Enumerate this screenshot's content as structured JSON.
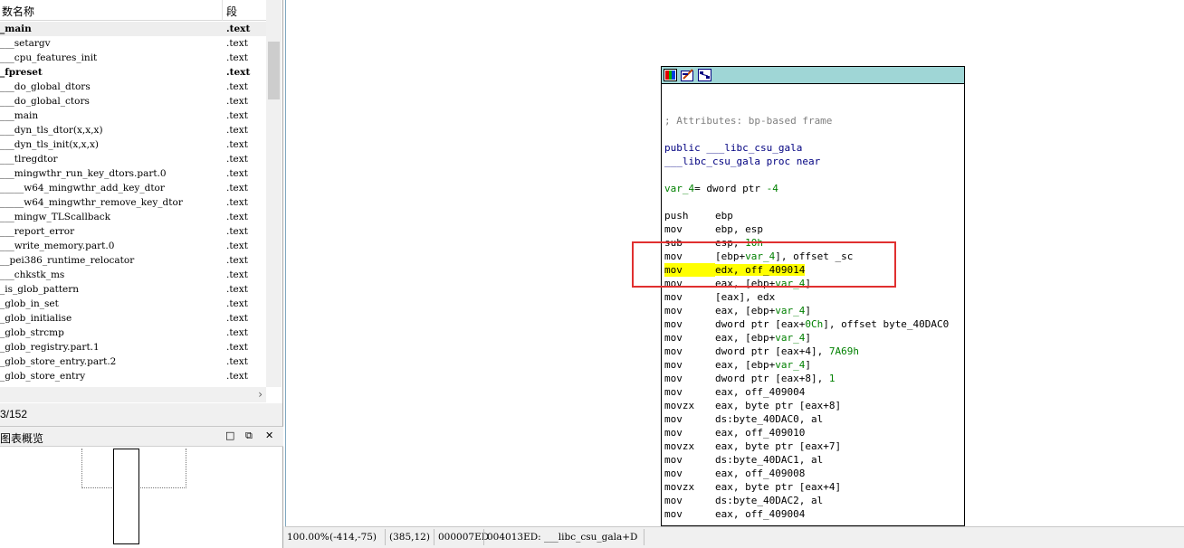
{
  "functions_panel": {
    "col_name": "数名称",
    "col_segment": "段",
    "rows": [
      {
        "name": "_main",
        "segment": ".text",
        "bold": true,
        "selected": true
      },
      {
        "name": "___setargv",
        "segment": ".text"
      },
      {
        "name": "___cpu_features_init",
        "segment": ".text"
      },
      {
        "name": "_fpreset",
        "segment": ".text",
        "bold": true
      },
      {
        "name": "___do_global_dtors",
        "segment": ".text"
      },
      {
        "name": "___do_global_ctors",
        "segment": ".text"
      },
      {
        "name": "___main",
        "segment": ".text"
      },
      {
        "name": "___dyn_tls_dtor(x,x,x)",
        "segment": ".text"
      },
      {
        "name": "___dyn_tls_init(x,x,x)",
        "segment": ".text"
      },
      {
        "name": "___tlregdtor",
        "segment": ".text"
      },
      {
        "name": "___mingwthr_run_key_dtors.part.0",
        "segment": ".text"
      },
      {
        "name": "_____w64_mingwthr_add_key_dtor",
        "segment": ".text"
      },
      {
        "name": "_____w64_mingwthr_remove_key_dtor",
        "segment": ".text"
      },
      {
        "name": "___mingw_TLScallback",
        "segment": ".text"
      },
      {
        "name": "___report_error",
        "segment": ".text"
      },
      {
        "name": "___write_memory.part.0",
        "segment": ".text"
      },
      {
        "name": "__pei386_runtime_relocator",
        "segment": ".text"
      },
      {
        "name": "___chkstk_ms",
        "segment": ".text"
      },
      {
        "name": "_is_glob_pattern",
        "segment": ".text"
      },
      {
        "name": "_glob_in_set",
        "segment": ".text"
      },
      {
        "name": "_glob_initialise",
        "segment": ".text"
      },
      {
        "name": "_glob_strcmp",
        "segment": ".text"
      },
      {
        "name": "_glob_registry.part.1",
        "segment": ".text"
      },
      {
        "name": "_glob_store_entry.part.2",
        "segment": ".text"
      },
      {
        "name": "_glob_store_entry",
        "segment": ".text"
      }
    ],
    "count": "3/152"
  },
  "overview_panel": {
    "title": "图表概览"
  },
  "graph_node": {
    "lines": [
      {
        "kind": "comment",
        "text": "; Attributes: bp-based frame"
      },
      {
        "kind": "blank"
      },
      {
        "kind": "plain",
        "text": "public ___libc_csu_gala",
        "class": "navy"
      },
      {
        "kind": "plain",
        "text": "___libc_csu_gala proc near",
        "class": "navy"
      },
      {
        "kind": "blank"
      },
      {
        "kind": "var",
        "name": "var_4",
        "rest": "= dword ptr ",
        "value": "-4"
      },
      {
        "kind": "blank"
      },
      {
        "kind": "ins",
        "mnem": "push",
        "ops": [
          {
            "t": "ebp"
          }
        ]
      },
      {
        "kind": "ins",
        "mnem": "mov",
        "ops": [
          {
            "t": "ebp, esp"
          }
        ]
      },
      {
        "kind": "ins",
        "mnem": "sub",
        "ops": [
          {
            "t": "esp, "
          },
          {
            "t": "10h",
            "c": "green"
          }
        ]
      },
      {
        "kind": "ins",
        "mnem": "mov",
        "ops": [
          {
            "t": "[ebp+"
          },
          {
            "t": "var_4",
            "c": "green"
          },
          {
            "t": "], offset _sc"
          }
        ]
      },
      {
        "kind": "ins",
        "mnem": "mov",
        "hl": true,
        "ops": [
          {
            "t": "edx, off_409014"
          }
        ]
      },
      {
        "kind": "ins",
        "mnem": "mov",
        "ops": [
          {
            "t": "eax, [ebp+"
          },
          {
            "t": "var_4",
            "c": "green"
          },
          {
            "t": "]"
          }
        ]
      },
      {
        "kind": "ins",
        "mnem": "mov",
        "ops": [
          {
            "t": "[eax], edx"
          }
        ]
      },
      {
        "kind": "ins",
        "mnem": "mov",
        "ops": [
          {
            "t": "eax, [ebp+"
          },
          {
            "t": "var_4",
            "c": "green"
          },
          {
            "t": "]"
          }
        ]
      },
      {
        "kind": "ins",
        "mnem": "mov",
        "ops": [
          {
            "t": "dword ptr [eax+"
          },
          {
            "t": "0Ch",
            "c": "green"
          },
          {
            "t": "], offset byte_40DAC0"
          }
        ]
      },
      {
        "kind": "ins",
        "mnem": "mov",
        "ops": [
          {
            "t": "eax, [ebp+"
          },
          {
            "t": "var_4",
            "c": "green"
          },
          {
            "t": "]"
          }
        ]
      },
      {
        "kind": "ins",
        "mnem": "mov",
        "ops": [
          {
            "t": "dword ptr [eax+4], "
          },
          {
            "t": "7A69h",
            "c": "green"
          }
        ]
      },
      {
        "kind": "ins",
        "mnem": "mov",
        "ops": [
          {
            "t": "eax, [ebp+"
          },
          {
            "t": "var_4",
            "c": "green"
          },
          {
            "t": "]"
          }
        ]
      },
      {
        "kind": "ins",
        "mnem": "mov",
        "ops": [
          {
            "t": "dword ptr [eax+8], "
          },
          {
            "t": "1",
            "c": "green"
          }
        ]
      },
      {
        "kind": "ins",
        "mnem": "mov",
        "ops": [
          {
            "t": "eax, off_409004"
          }
        ]
      },
      {
        "kind": "ins",
        "mnem": "movzx",
        "ops": [
          {
            "t": "eax, byte ptr [eax+8]"
          }
        ]
      },
      {
        "kind": "ins",
        "mnem": "mov",
        "ops": [
          {
            "t": "ds:byte_40DAC0, al"
          }
        ]
      },
      {
        "kind": "ins",
        "mnem": "mov",
        "ops": [
          {
            "t": "eax, off_409010"
          }
        ]
      },
      {
        "kind": "ins",
        "mnem": "movzx",
        "ops": [
          {
            "t": "eax, byte ptr [eax+7]"
          }
        ]
      },
      {
        "kind": "ins",
        "mnem": "mov",
        "ops": [
          {
            "t": "ds:byte_40DAC1, al"
          }
        ]
      },
      {
        "kind": "ins",
        "mnem": "mov",
        "ops": [
          {
            "t": "eax, off_409008"
          }
        ]
      },
      {
        "kind": "ins",
        "mnem": "movzx",
        "ops": [
          {
            "t": "eax, byte ptr [eax+4]"
          }
        ]
      },
      {
        "kind": "ins",
        "mnem": "mov",
        "ops": [
          {
            "t": "ds:byte_40DAC2, al"
          }
        ]
      },
      {
        "kind": "ins",
        "mnem": "mov",
        "ops": [
          {
            "t": "eax, off_409004"
          }
        ]
      }
    ]
  },
  "status_bar": {
    "zoom": "100.00%",
    "mouse_pos": "(-414,-75)",
    "graph_pos": "(385,12)",
    "file_offset": "000007ED",
    "location": "004013ED: ___libc_csu_gala+D"
  },
  "colors": {
    "node_titlebar": "#9fd6d6",
    "highlight": "#ffff00",
    "annotation_box": "#e03030",
    "operand_green": "#008000",
    "name_navy": "#000080"
  }
}
